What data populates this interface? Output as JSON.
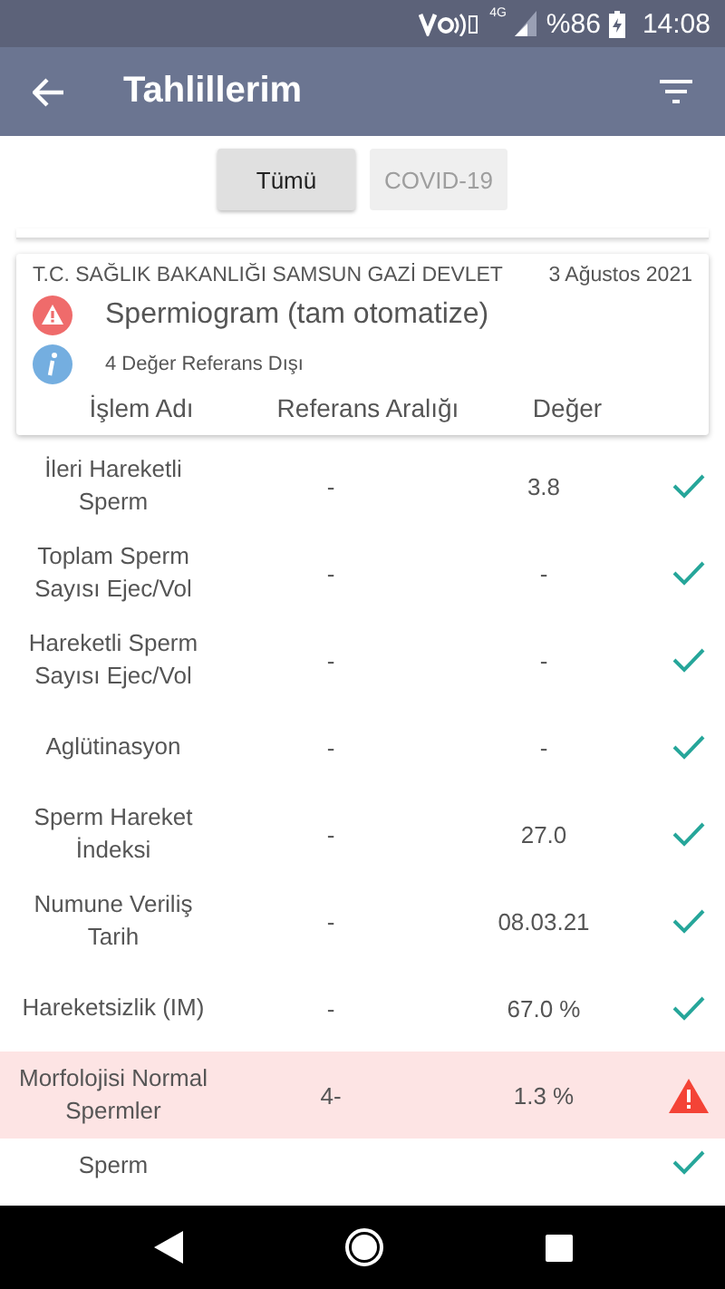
{
  "status_bar": {
    "network": "4G",
    "battery": "%86",
    "time": "14:08"
  },
  "app_bar": {
    "title": "Tahlillerim"
  },
  "tabs": [
    {
      "label": "Tümü",
      "selected": true
    },
    {
      "label": "COVID-19",
      "selected": false
    }
  ],
  "card": {
    "hospital": "T.C. SAĞLIK BAKANLIĞI SAMSUN GAZİ DEVLET",
    "date": "3 Ağustos 2021",
    "test": "Spermiogram (tam otomatize)",
    "info": "4 Değer Referans Dışı",
    "columns": [
      "İşlem Adı",
      "Referans Aralığı",
      "Değer"
    ]
  },
  "rows": [
    {
      "name": "İleri Hareketli Sperm",
      "range": "-",
      "value": "3.8",
      "out_of_range": false
    },
    {
      "name": "Toplam Sperm Sayısı Ejec/Vol",
      "range": "-",
      "value": "-",
      "out_of_range": false
    },
    {
      "name": "Hareketli Sperm Sayısı Ejec/Vol",
      "range": "-",
      "value": "-",
      "out_of_range": false
    },
    {
      "name": "Aglütinasyon",
      "range": "-",
      "value": "-",
      "out_of_range": false
    },
    {
      "name": "Sperm Hareket İndeksi",
      "range": "-",
      "value": "27.0",
      "out_of_range": false
    },
    {
      "name": "Numune Veriliş Tarih",
      "range": "-",
      "value": "08.03.21",
      "out_of_range": false
    },
    {
      "name": "Hareketsizlik (IM)",
      "range": "-",
      "value": "67.0 %",
      "out_of_range": false
    },
    {
      "name": "Morfolojisi Normal Spermler",
      "range": "4-",
      "value": "1.3 %",
      "out_of_range": true
    },
    {
      "name": "Sperm",
      "out_of_range": false
    }
  ]
}
